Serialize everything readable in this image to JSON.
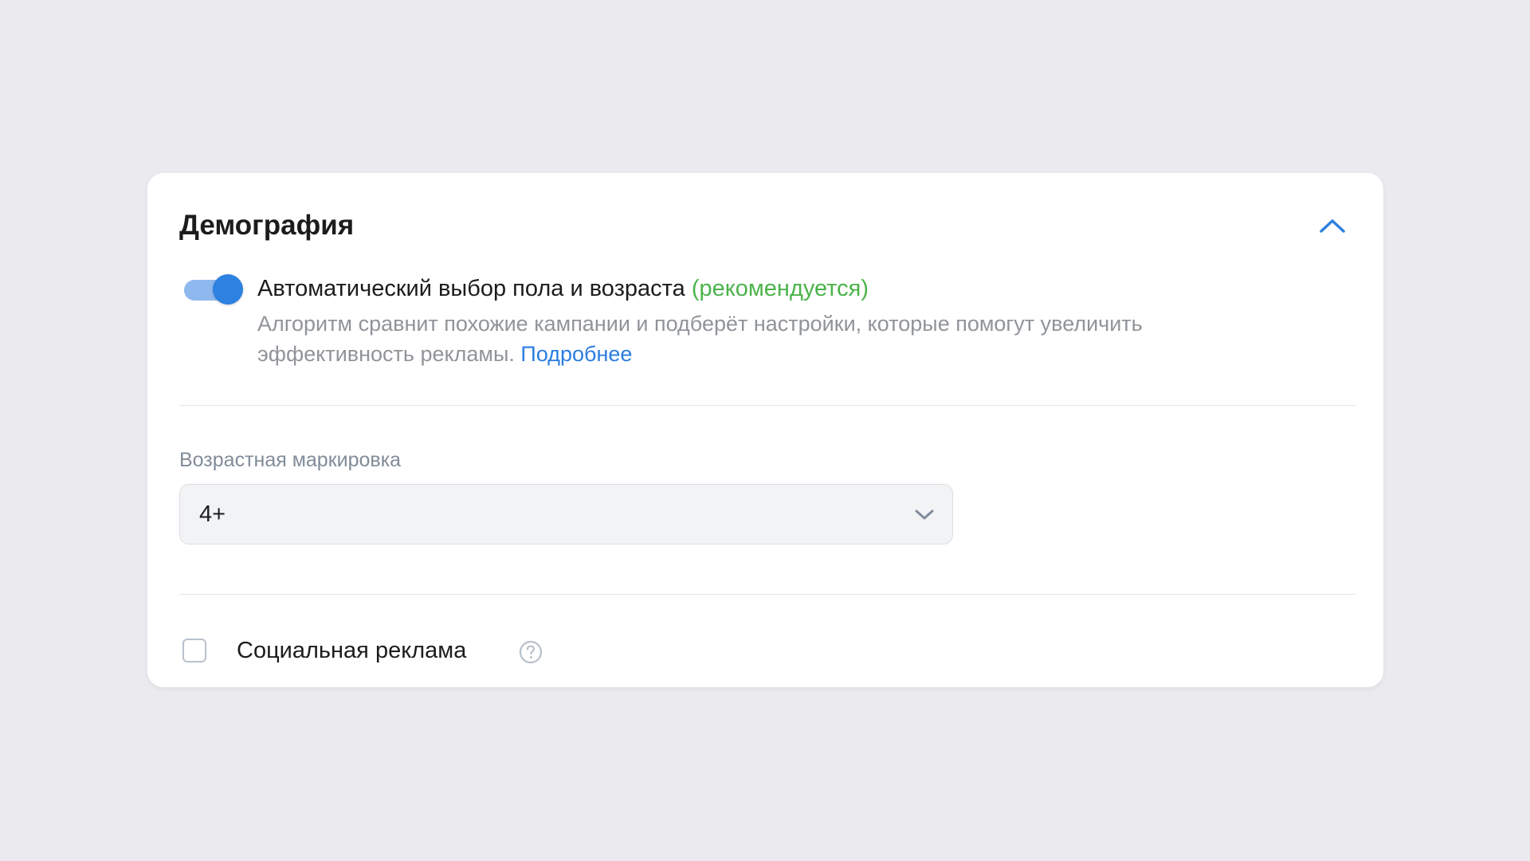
{
  "section": {
    "title": "Демография"
  },
  "auto_demography": {
    "label": "Автоматический выбор пола и возраста",
    "recommended": "(рекомендуется)",
    "description": "Алгоритм сравнит похожие кампании и подберёт настройки, которые помогут увеличить эффективность рекламы.",
    "more_link": "Подробнее",
    "enabled": true
  },
  "age_rating": {
    "label": "Возрастная маркировка",
    "value": "4+"
  },
  "social_ad": {
    "label": "Социальная реклама",
    "checked": false
  },
  "colors": {
    "accent": "#2d81e0",
    "recommended": "#4bb34b",
    "background": "#ebebef"
  },
  "icons": {
    "collapse": "chevron-up-icon",
    "select": "chevron-down-icon",
    "help": "question-circle-icon"
  }
}
